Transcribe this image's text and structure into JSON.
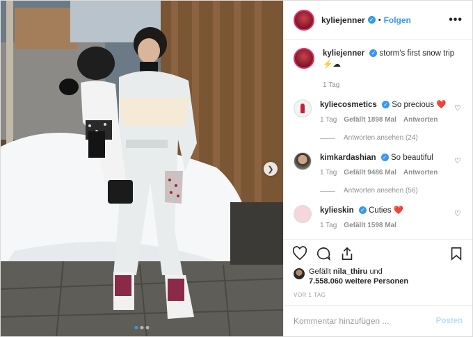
{
  "header": {
    "username": "kyliejenner",
    "verified_icon": "verified-badge-icon",
    "separator": "•",
    "follow_label": "Folgen",
    "more_icon": "more-options-icon",
    "more_glyph": "•••"
  },
  "caption": {
    "username": "kyliejenner",
    "text": "storm's first snow trip",
    "emoji": "⚡☁",
    "time": "1 Tag"
  },
  "comments": [
    {
      "username": "kyliecosmetics",
      "text": "So precious",
      "emoji": "❤️",
      "time": "1 Tag",
      "likes": "Gefällt 1898 Mal",
      "reply": "Antworten",
      "view_replies": "Antworten ansehen (24)"
    },
    {
      "username": "kimkardashian",
      "text": "So beautiful",
      "emoji": "",
      "time": "1 Tag",
      "likes": "Gefällt 9486 Mal",
      "reply": "Antworten",
      "view_replies": "Antworten ansehen (56)"
    },
    {
      "username": "kylieskin",
      "text": "Cuties",
      "emoji": "❤️",
      "time": "1 Tag",
      "likes": "Gefällt 1598 Mal",
      "reply": "",
      "view_replies": ""
    }
  ],
  "actions": {
    "like_icon": "heart-icon",
    "comment_icon": "comment-icon",
    "share_icon": "share-icon",
    "save_icon": "bookmark-icon"
  },
  "likes": {
    "prefix": "Gefällt",
    "user": "nila_thiru",
    "conj": "und",
    "count": "7.558.060 weitere Personen"
  },
  "date": "VOR 1 TAG",
  "add_comment": {
    "placeholder": "Kommentar hinzufügen ...",
    "post_label": "Posten"
  },
  "carousel": {
    "next_icon": "chevron-right-icon",
    "next_glyph": "❯",
    "dots": 3,
    "active_index": 0
  },
  "colors": {
    "accent": "#3897f0",
    "post_disabled": "#b2dffc",
    "heart_red": "#ed4956"
  }
}
